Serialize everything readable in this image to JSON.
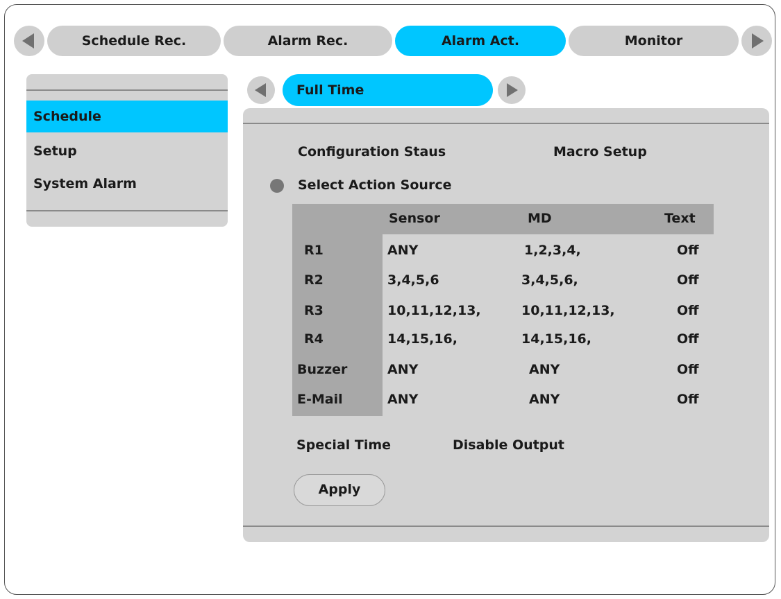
{
  "tabs": [
    "Schedule Rec.",
    "Alarm Rec.",
    "Alarm Act.",
    "Monitor"
  ],
  "active_tab": "Alarm Act.",
  "menu": {
    "items": [
      "Schedule",
      "Setup",
      "System Alarm"
    ],
    "selected": "Schedule"
  },
  "subtab": {
    "label": "Full Time"
  },
  "panel": {
    "config_status": "Configuration Staus",
    "macro_setup": "Macro Setup",
    "select_action_source": "Select Action Source",
    "special_time": "Special Time",
    "disable_output": "Disable Output",
    "apply": "Apply"
  },
  "table": {
    "columns": [
      "Sensor",
      "MD",
      "Text"
    ],
    "rows": [
      {
        "label": "R1",
        "sensor": "ANY",
        "md": "1,2,3,4,",
        "text": "Off"
      },
      {
        "label": "R2",
        "sensor": "3,4,5,6",
        "md": "3,4,5,6,",
        "text": "Off"
      },
      {
        "label": "R3",
        "sensor": "10,11,12,13,",
        "md": "10,11,12,13,",
        "text": "Off"
      },
      {
        "label": "R4",
        "sensor": "14,15,16,",
        "md": "14,15,16,",
        "text": "Off"
      },
      {
        "label": "Buzzer",
        "sensor": "ANY",
        "md": "ANY",
        "text": "Off"
      },
      {
        "label": "E-Mail",
        "sensor": "ANY",
        "md": "ANY",
        "text": "Off"
      }
    ]
  },
  "colors": {
    "accent": "#00c6ff",
    "panel": "#d3d3d3",
    "table_header": "#a8a8a8"
  },
  "icons": [
    "left-arrow-icon",
    "right-arrow-icon",
    "radio-indicator-icon"
  ]
}
